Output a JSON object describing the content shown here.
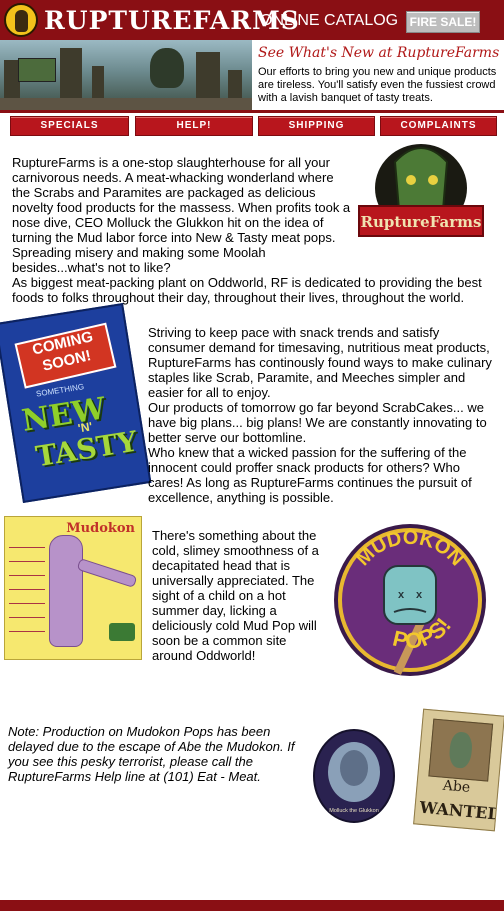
{
  "header": {
    "brand": "RUPTUREFARMS",
    "catalog_label": "ONLINE CATALOG",
    "fire_sale_label": "FIRE SALE!"
  },
  "banner": {
    "headline": "See What's New at RuptureFarms",
    "body": "Our efforts to bring you new and unique products are tireless. You'll satisfy even the fussiest crowd with a lavish banquet of tasty treats."
  },
  "nav": {
    "items": [
      {
        "label": "SPECIALS"
      },
      {
        "label": "HELP!"
      },
      {
        "label": "SHIPPING"
      },
      {
        "label": "COMPLAINTS"
      }
    ]
  },
  "intro": {
    "para1": "RuptureFarms is a one-stop slaughterhouse for all your carnivorous needs. A meat-whacking wonderland where the Scrabs and Paramites are packaged as delicious novelty food products for the massess. When profits took a nose dive, CEO Molluck the Glukkon hit on the idea of turning the Mud labor force into New & Tasty meat pops. Spreading misery and making some Moolah besides...what's not to like?",
    "para2": "As biggest meat-packing plant on Oddworld, RF is dedicated to providing the best foods to folks throughout their day, throughout their lives, throughout the world."
  },
  "rf_logo_text": "RuptureFarms",
  "coming_soon": {
    "top": "COMING SOON!",
    "small": "SOMETHING",
    "new": "NEW",
    "n": "'N'",
    "tasty": "TASTY"
  },
  "middle": {
    "para1": "Striving to keep pace with snack trends and satisfy consumer demand for timesaving, nutritious meat products, RuptureFarms has continously found ways to make culinary staples like Scrab, Paramite, and Meeches simpler and easier for all to enjoy.",
    "para2": "Our products of tomorrow go far beyond ScrabCakes... we have big plans... big plans! We are constantly innovating to better serve our bottomline.",
    "para3": "Who knew that a wicked passion for the suffering of the innocent could proffer snack products for others? Who cares! As long as RuptureFarms continues the pursuit of excellence, anything is possible."
  },
  "chart_poster_title": "Mudokon",
  "mud_pop": {
    "text": "There's something about the cold, slimey smoothness of a decapitated head that is universally appreciated. The sight of a child on a hot summer day, licking a deliciously cold Mud Pop will soon be a common site around Oddworld!",
    "badge_top": "MUDOKON",
    "badge_bottom": "POPS!"
  },
  "note": {
    "text": "Note: Production on Mudokon Pops has been delayed due to the escape of Abe the Mudokon. If you see this pesky terrorist, please call the RuptureFarms Help line at (101) Eat - Meat."
  },
  "slig_caption": "Molluck the Glukkon",
  "wanted": {
    "name": "Abe",
    "word": "WANTED"
  },
  "colors": {
    "brand_red": "#8a0f14",
    "nav_red": "#b8161d",
    "headline_red": "#b01818"
  }
}
